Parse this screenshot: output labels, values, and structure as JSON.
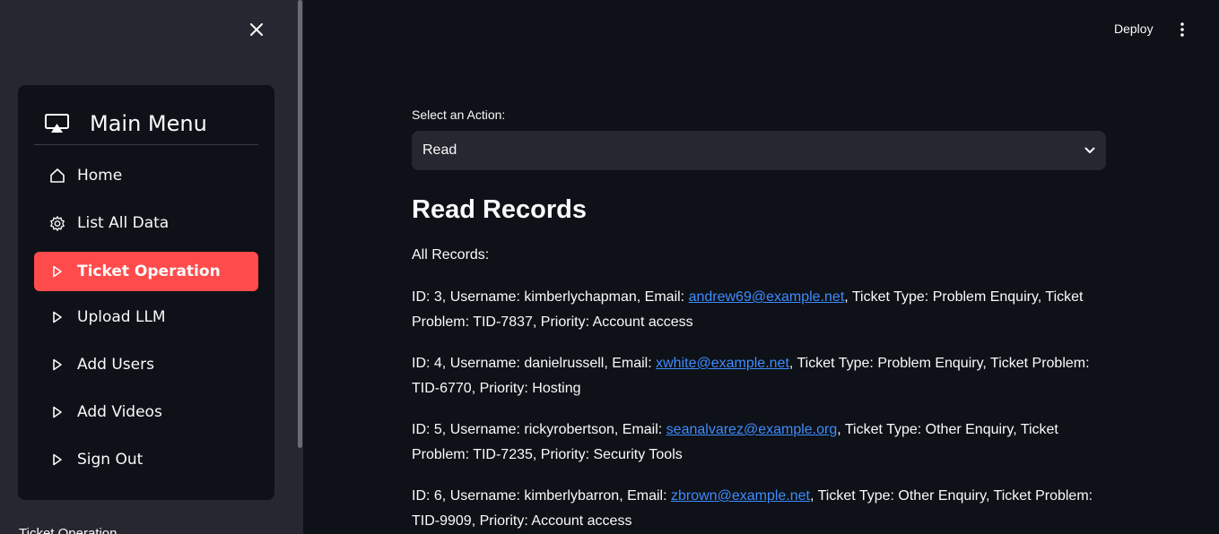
{
  "sidebar": {
    "menu_title": "Main Menu",
    "items": [
      {
        "label": "Home",
        "icon": "home-icon"
      },
      {
        "label": "List All Data",
        "icon": "gear-icon"
      },
      {
        "label": "Ticket Operation",
        "icon": "play-icon",
        "active": true
      },
      {
        "label": "Upload LLM",
        "icon": "play-icon"
      },
      {
        "label": "Add Users",
        "icon": "play-icon"
      },
      {
        "label": "Add Videos",
        "icon": "play-icon"
      },
      {
        "label": "Sign Out",
        "icon": "play-icon"
      }
    ],
    "footer_text": "Ticket Operation"
  },
  "topbar": {
    "deploy_label": "Deploy"
  },
  "main": {
    "select_label": "Select an Action:",
    "select_value": "Read",
    "heading": "Read Records",
    "all_records_label": "All Records:",
    "records": [
      {
        "id": "3",
        "username": "kimberlychapman",
        "email": "andrew69@example.net",
        "ticket_type": "Problem Enquiry",
        "ticket_problem": "TID-7837",
        "priority": "Account access"
      },
      {
        "id": "4",
        "username": "danielrussell",
        "email": "xwhite@example.net",
        "ticket_type": "Problem Enquiry",
        "ticket_problem": "TID-6770",
        "priority": "Hosting"
      },
      {
        "id": "5",
        "username": "rickyrobertson",
        "email": "seanalvarez@example.org",
        "ticket_type": "Other Enquiry",
        "ticket_problem": "TID-7235",
        "priority": "Security Tools"
      },
      {
        "id": "6",
        "username": "kimberlybarron",
        "email": "zbrown@example.net",
        "ticket_type": "Other Enquiry",
        "ticket_problem": "TID-9909",
        "priority": "Account access"
      }
    ]
  },
  "colors": {
    "accent": "#ff4b4b",
    "link": "#3d8cff",
    "background": "#0e1117",
    "sidebar": "#262730"
  }
}
